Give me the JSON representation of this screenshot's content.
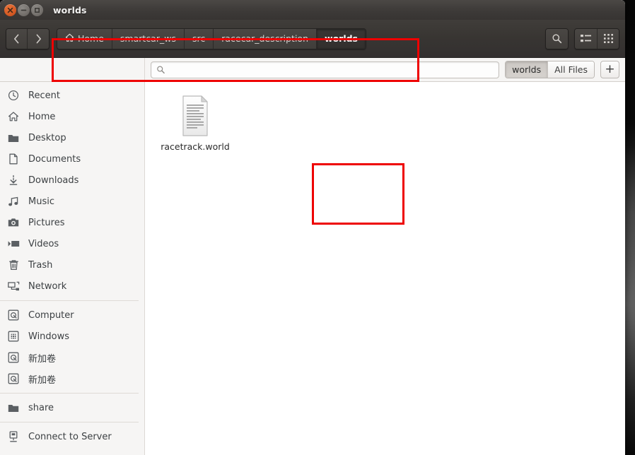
{
  "window": {
    "title": "worlds",
    "controls": [
      {
        "name": "close",
        "glyph": "×"
      },
      {
        "name": "minimize",
        "glyph": "−"
      },
      {
        "name": "maximize",
        "glyph": "□"
      }
    ]
  },
  "toolbar": {
    "back_label": "‹",
    "forward_label": "›",
    "search_icon": "search-icon",
    "list_view_icon": "list-view-icon",
    "grid_view_icon": "grid-view-icon",
    "breadcrumb": [
      {
        "label": "Home",
        "icon": "home-icon",
        "active": false
      },
      {
        "label": "smartcar_ws",
        "icon": "",
        "active": false
      },
      {
        "label": "src",
        "icon": "",
        "active": false
      },
      {
        "label": "racecar_description",
        "icon": "",
        "active": false
      },
      {
        "label": "worlds",
        "icon": "",
        "active": true
      }
    ]
  },
  "search": {
    "value": "",
    "placeholder": ""
  },
  "tabs": {
    "items": [
      {
        "label": "worlds",
        "active": true
      },
      {
        "label": "All Files",
        "active": false
      }
    ],
    "new_tab_label": "+"
  },
  "sidebar": {
    "groups": [
      {
        "items": [
          {
            "label": "Recent",
            "icon": "clock-icon"
          },
          {
            "label": "Home",
            "icon": "home-icon"
          },
          {
            "label": "Desktop",
            "icon": "folder-icon"
          },
          {
            "label": "Documents",
            "icon": "document-icon"
          },
          {
            "label": "Downloads",
            "icon": "download-icon"
          },
          {
            "label": "Music",
            "icon": "music-icon"
          },
          {
            "label": "Pictures",
            "icon": "camera-icon"
          },
          {
            "label": "Videos",
            "icon": "video-icon"
          },
          {
            "label": "Trash",
            "icon": "trash-icon"
          },
          {
            "label": "Network",
            "icon": "network-icon"
          }
        ]
      },
      {
        "items": [
          {
            "label": "Computer",
            "icon": "drive-icon"
          },
          {
            "label": "Windows",
            "icon": "windows-drive-icon"
          },
          {
            "label": "新加卷",
            "icon": "drive-icon"
          },
          {
            "label": "新加卷",
            "icon": "drive-icon"
          }
        ]
      },
      {
        "items": [
          {
            "label": "share",
            "icon": "folder-icon"
          }
        ]
      },
      {
        "items": [
          {
            "label": "Connect to Server",
            "icon": "server-icon"
          }
        ]
      }
    ]
  },
  "content": {
    "files": [
      {
        "name": "racetrack.world",
        "icon": "text-document-icon"
      }
    ]
  },
  "annotations": {
    "color": "#ee0000",
    "boxes": [
      {
        "name": "breadcrumb-highlight"
      },
      {
        "name": "file-highlight"
      }
    ]
  }
}
